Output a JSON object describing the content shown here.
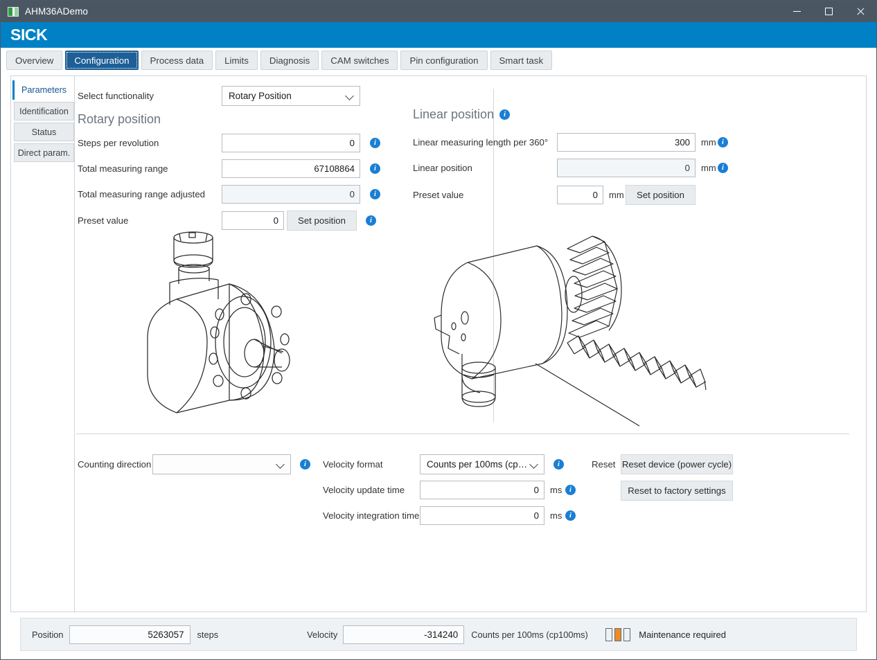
{
  "window": {
    "title": "AHM36ADemo",
    "brand": "SICK",
    "controls": {
      "minimize": "minimize-icon",
      "maximize": "maximize-icon",
      "close": "close-icon"
    }
  },
  "tabs": [
    {
      "label": "Overview",
      "active": false
    },
    {
      "label": "Configuration",
      "active": true
    },
    {
      "label": "Process data",
      "active": false
    },
    {
      "label": "Limits",
      "active": false
    },
    {
      "label": "Diagnosis",
      "active": false
    },
    {
      "label": "CAM switches",
      "active": false
    },
    {
      "label": "Pin configuration",
      "active": false
    },
    {
      "label": "Smart task",
      "active": false
    }
  ],
  "side_tabs": [
    {
      "label": "Parameters",
      "active": true
    },
    {
      "label": "Identification",
      "active": false
    },
    {
      "label": "Status",
      "active": false
    },
    {
      "label": "Direct param.",
      "active": false
    }
  ],
  "functionality": {
    "label": "Select functionality",
    "value": "Rotary Position"
  },
  "rotary": {
    "title": "Rotary position",
    "fields": [
      {
        "label": "Steps per revolution",
        "value": "0",
        "readonly": false
      },
      {
        "label": "Total measuring range",
        "value": "67108864",
        "readonly": false
      },
      {
        "label": "Total measuring range adjusted",
        "value": "0",
        "readonly": true
      }
    ],
    "preset": {
      "label": "Preset value",
      "value": "0",
      "button": "Set position"
    }
  },
  "linear": {
    "title": "Linear position",
    "fields": [
      {
        "label": "Linear measuring length per 360°",
        "value": "300",
        "unit": "mm",
        "readonly": false
      },
      {
        "label": "Linear position",
        "value": "0",
        "unit": "mm",
        "readonly": true
      }
    ],
    "preset": {
      "label": "Preset value",
      "value": "0",
      "unit": "mm",
      "button": "Set position"
    }
  },
  "bottom": {
    "counting_direction": {
      "label": "Counting direction",
      "value": ""
    },
    "velocity_format": {
      "label": "Velocity format",
      "value": "Counts per 100ms (cp…"
    },
    "velocity_update": {
      "label": "Velocity update time",
      "value": "0",
      "unit": "ms"
    },
    "velocity_integration": {
      "label": "Velocity integration time",
      "value": "0",
      "unit": "ms"
    },
    "reset": {
      "label": "Reset",
      "device_button": "Reset device (power cycle)",
      "factory_button": "Reset to factory settings"
    }
  },
  "statusbar": {
    "position_label": "Position",
    "position_value": "5263057",
    "position_unit": "steps",
    "velocity_label": "Velocity",
    "velocity_value": "-314240",
    "velocity_unit": "Counts per 100ms (cp100ms)",
    "status_text": "Maintenance required"
  },
  "colors": {
    "brand_blue": "#0081c6",
    "tab_active": "#1d5f96",
    "info_blue": "#1a7fd4",
    "status_orange": "#ef8b22",
    "titlebar": "#4a5763"
  }
}
